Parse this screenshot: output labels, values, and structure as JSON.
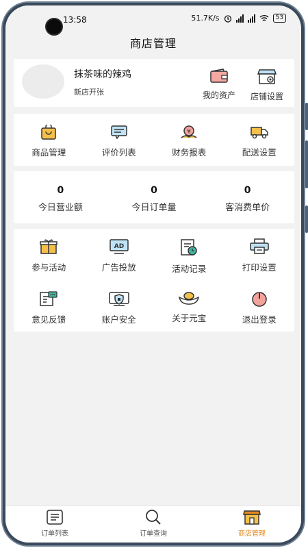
{
  "status_bar": {
    "time": "13:58",
    "net_speed": "51.7K/s",
    "battery": "53"
  },
  "header": {
    "title": "商店管理"
  },
  "store": {
    "name": "抹茶味的辣鸡",
    "status": "新店开张",
    "actions": [
      {
        "label": "我的资产",
        "icon": "wallet-icon"
      },
      {
        "label": "店铺设置",
        "icon": "store-settings-icon"
      }
    ]
  },
  "management": [
    {
      "label": "商品管理",
      "icon": "shopping-bag-icon"
    },
    {
      "label": "评价列表",
      "icon": "comment-icon"
    },
    {
      "label": "财务报表",
      "icon": "finance-icon"
    },
    {
      "label": "配送设置",
      "icon": "delivery-truck-icon"
    }
  ],
  "stats": [
    {
      "value": "0",
      "label": "今日营业额"
    },
    {
      "value": "0",
      "label": "今日订单量"
    },
    {
      "value": "0",
      "label": "客消费单价"
    }
  ],
  "menu_row1": [
    {
      "label": "参与活动",
      "icon": "gift-icon"
    },
    {
      "label": "广告投放",
      "icon": "ad-icon"
    },
    {
      "label": "活动记录",
      "icon": "activity-record-icon"
    },
    {
      "label": "打印设置",
      "icon": "printer-icon"
    }
  ],
  "menu_row2": [
    {
      "label": "意见反馈",
      "icon": "feedback-icon"
    },
    {
      "label": "账户安全",
      "icon": "account-security-icon"
    },
    {
      "label": "关于元宝",
      "icon": "ingot-icon"
    },
    {
      "label": "退出登录",
      "icon": "power-icon"
    }
  ],
  "bottom_nav": [
    {
      "label": "订单列表",
      "icon": "order-list-icon"
    },
    {
      "label": "订单查询",
      "icon": "search-icon"
    },
    {
      "label": "商店管理",
      "icon": "store-icon",
      "active": true
    }
  ],
  "colors": {
    "accent": "#e08a1e",
    "brand_orange": "#f5a623",
    "icon_dark": "#333333"
  }
}
